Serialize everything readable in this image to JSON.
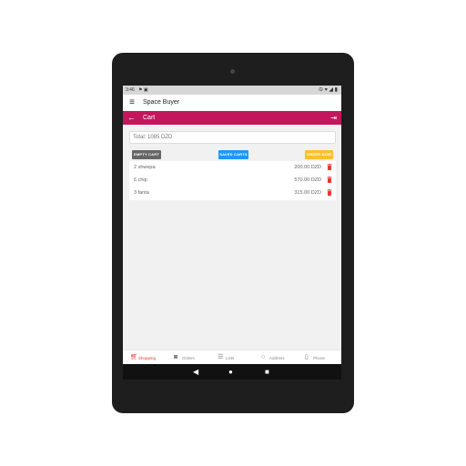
{
  "status": {
    "time": "3:46",
    "notifications": "⚑ ▣",
    "indicators": "⊝ ▾ ◢ ▮"
  },
  "app": {
    "title": "Space Buyer",
    "menu_icon": "hamburger-icon"
  },
  "cart": {
    "title": "Cart",
    "total": "Total: 1085 DZD",
    "buttons": {
      "empty": "EMPTY CART",
      "saved": "SAVED CARTS",
      "order": "ORDER NOW"
    },
    "items": [
      {
        "name": "2 shwepa",
        "price": "200.00 DZD"
      },
      {
        "name": "6 chip",
        "price": "570.00 DZD"
      },
      {
        "name": "3 fanta",
        "price": "315.00 DZD"
      }
    ]
  },
  "nav": {
    "items": [
      {
        "label": "Shopping",
        "icon": "cart-icon",
        "active": true
      },
      {
        "label": "Orders",
        "icon": "camera-icon",
        "active": false
      },
      {
        "label": "Lists",
        "icon": "list-icon",
        "active": false
      },
      {
        "label": "Address",
        "icon": "location-icon",
        "active": false
      },
      {
        "label": "Phone",
        "icon": "phone-icon",
        "active": false
      }
    ]
  },
  "colors": {
    "primary": "#c2185b",
    "accent": "#e53935",
    "saved": "#2196f3",
    "order": "#fbc02d",
    "empty": "#666666"
  }
}
